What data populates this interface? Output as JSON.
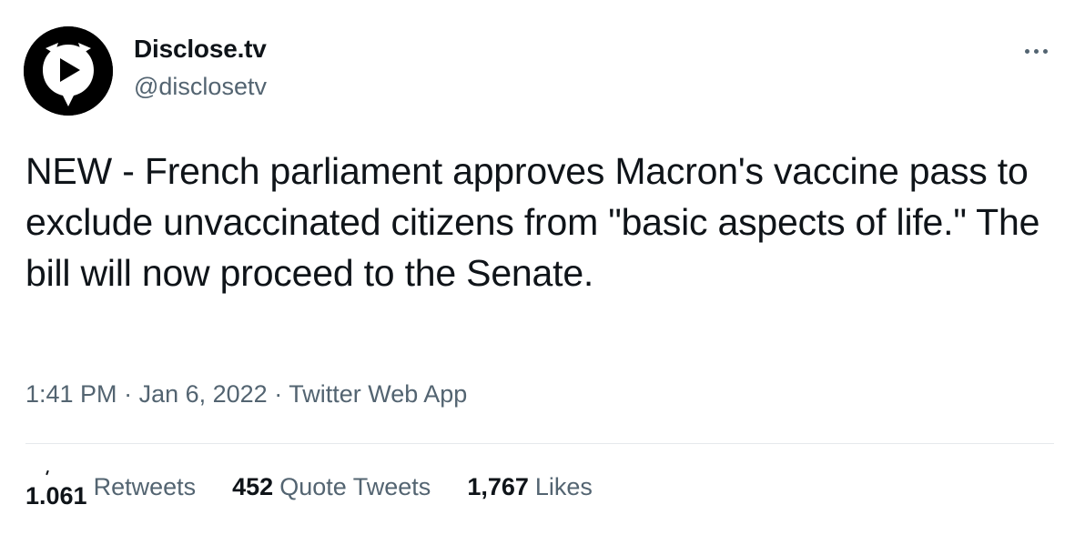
{
  "author": {
    "display_name": "Disclose.tv",
    "handle": "@disclosetv",
    "avatar_icon": "play-speech-bubble-icon"
  },
  "more_icon": "ellipsis-icon",
  "tweet": {
    "text": "NEW - French parliament approves Macron's vaccine pass to exclude unvaccinated citizens from \"basic aspects of life.\" The bill will now proceed to the Senate."
  },
  "meta": {
    "time": "1:41 PM",
    "separator1": " · ",
    "date": "Jan 6, 2022",
    "separator2": " · ",
    "app": "Twitter Web App"
  },
  "stats": {
    "retweets_count": "1.061",
    "retweets_label": "Retweets",
    "quotes_count": "452",
    "quotes_label": "Quote Tweets",
    "likes_count": "1,767",
    "likes_label": "Likes"
  },
  "colors": {
    "text": "#0f1419",
    "secondary": "#536471",
    "divider": "#e6e9ec"
  }
}
